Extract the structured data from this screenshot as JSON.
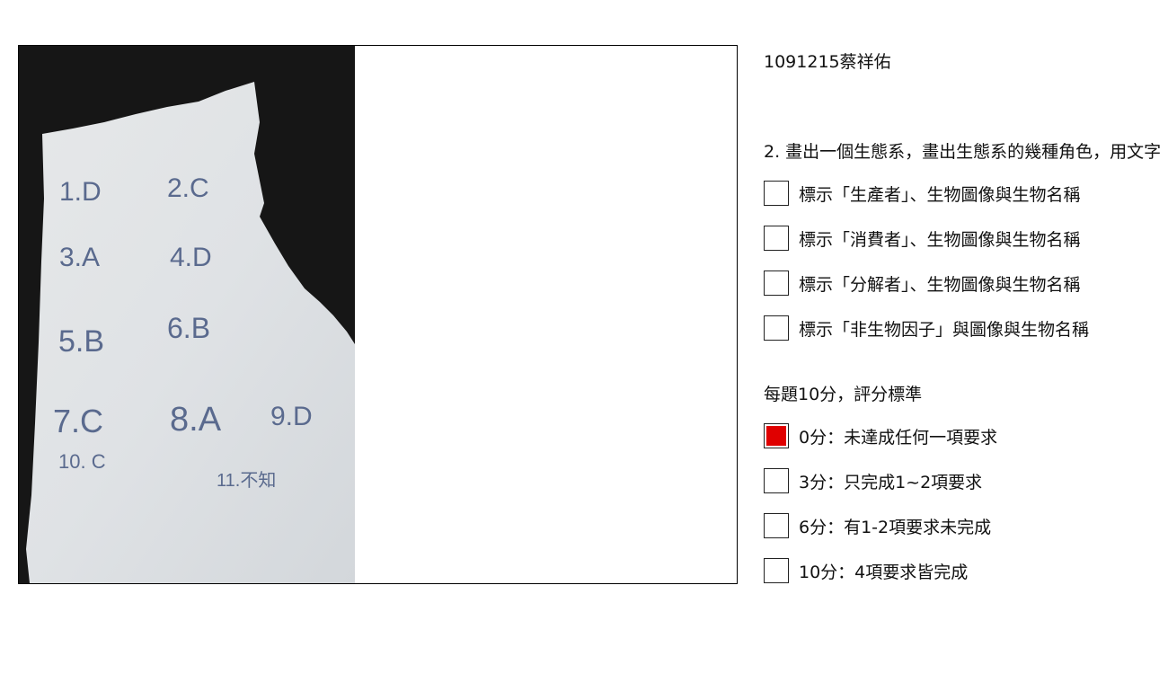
{
  "student_label": "1091215蔡祥佑",
  "question": {
    "text": "2. 畫出一個生態系，畫出生態系的幾種角色，用文字",
    "criteria": [
      {
        "label": "標示「生產者」、生物圖像與生物名稱",
        "checked": false
      },
      {
        "label": "標示「消費者」、生物圖像與生物名稱",
        "checked": false
      },
      {
        "label": "標示「分解者」、生物圖像與生物名稱",
        "checked": false
      },
      {
        "label": "標示「非生物因子」與圖像與生物名稱",
        "checked": false
      }
    ]
  },
  "scoring": {
    "title": "每題10分，評分標準",
    "options": [
      {
        "label": "0分：未達成任何一項要求",
        "checked": true
      },
      {
        "label": "3分：只完成1~2項要求",
        "checked": false
      },
      {
        "label": "6分：有1-2項要求未完成",
        "checked": false
      },
      {
        "label": "10分：4項要求皆完成",
        "checked": false
      }
    ]
  },
  "photo_answers": [
    "1.D",
    "2.C",
    "3.A",
    "4.D",
    "5.B",
    "6.B",
    "7.C",
    "8.A",
    "9.D",
    "10. C",
    "11.不知"
  ],
  "colors": {
    "checked": "#e00000",
    "ink": "#5a6a8e"
  }
}
